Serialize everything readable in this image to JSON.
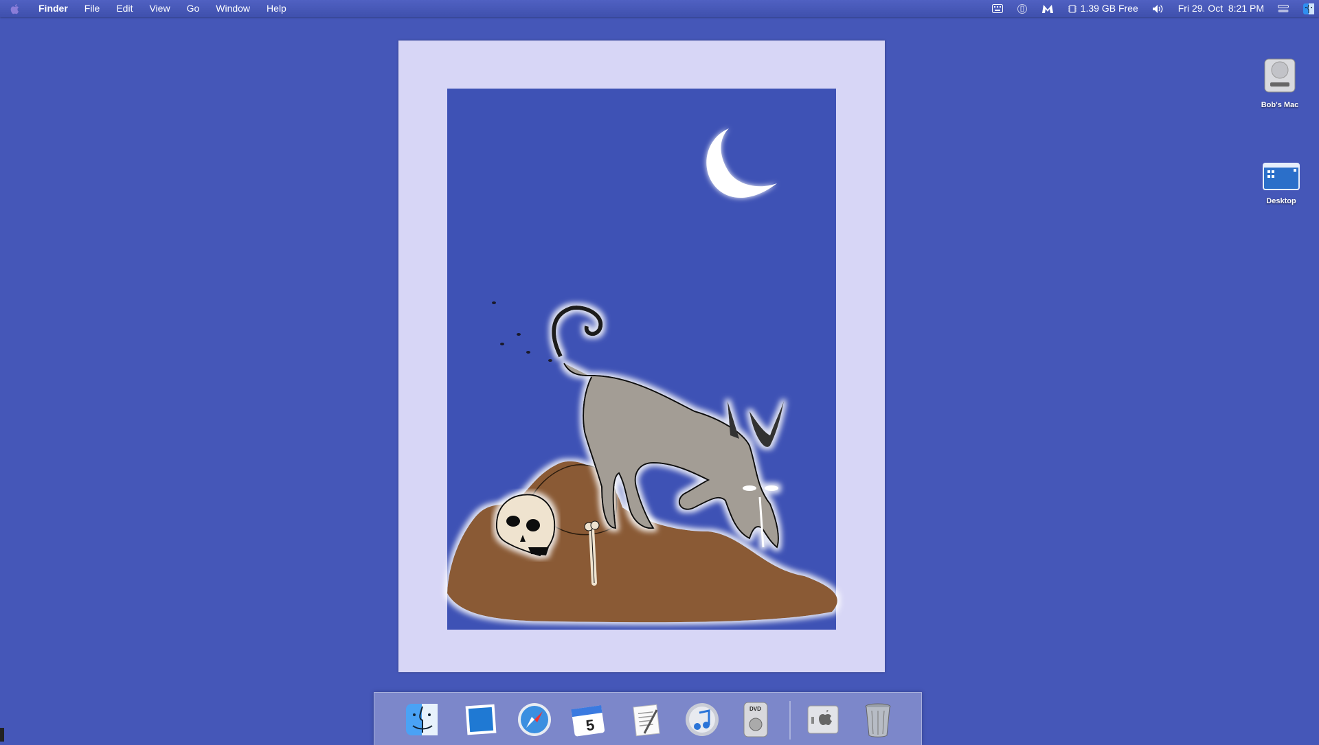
{
  "menubar": {
    "app_name": "Finder",
    "menus": [
      "File",
      "Edit",
      "View",
      "Go",
      "Window",
      "Help"
    ],
    "disk_free": "1.39 GB Free",
    "datetime": "Fri 29. Oct  8:21 PM"
  },
  "desktop": {
    "icons": [
      {
        "label": "Bob's Mac",
        "icon": "hard-drive-icon"
      },
      {
        "label": "Desktop",
        "icon": "desktop-folder-icon"
      }
    ]
  },
  "poster": {
    "calendar_day": "5",
    "colors": {
      "mat": "#d7d6f6",
      "sky": "#3e52b5",
      "dirt": "#8a5a34",
      "dog": "#a39d95"
    }
  },
  "dock": {
    "items": [
      "finder-icon",
      "preview-icon",
      "safari-icon",
      "calendar-icon",
      "textedit-icon",
      "itunes-icon",
      "dvd-player-icon",
      "system-info-icon",
      "trash-icon"
    ]
  }
}
